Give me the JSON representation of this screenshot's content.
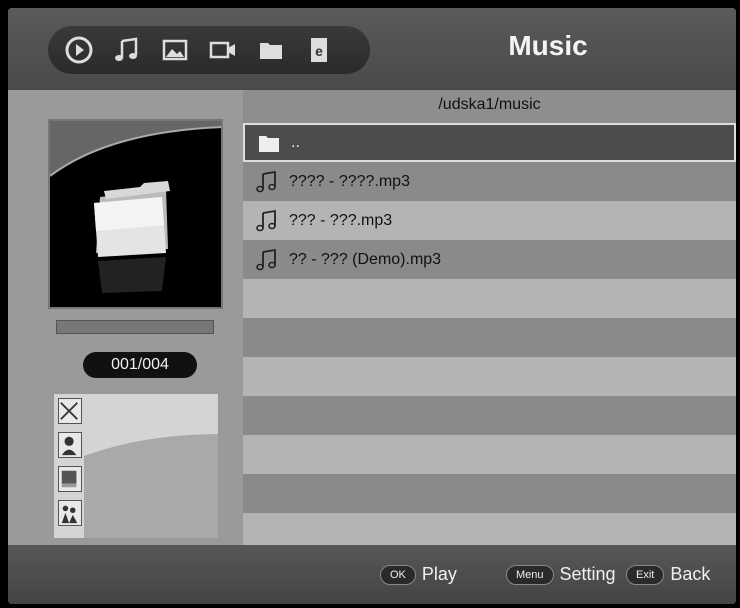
{
  "header": {
    "title": "Music",
    "icons": [
      "play-icon",
      "music-note-icon",
      "photo-icon",
      "video-icon",
      "folder-icon",
      "ebook-icon"
    ]
  },
  "left_panel": {
    "counter": "001/004"
  },
  "file_list": {
    "path": "/udska1/music",
    "items": [
      {
        "label": "..",
        "icon": "folder-icon"
      },
      {
        "label": "???? - ????.mp3",
        "icon": "music-file-icon"
      },
      {
        "label": "??? - ???.mp3",
        "icon": "music-file-icon"
      },
      {
        "label": "?? - ??? (Demo).mp3",
        "icon": "music-file-icon"
      }
    ]
  },
  "footer": {
    "hints": [
      {
        "key": "OK",
        "label": "Play"
      },
      {
        "key": "Menu",
        "label": "Setting"
      },
      {
        "key": "Exit",
        "label": "Back"
      }
    ]
  }
}
